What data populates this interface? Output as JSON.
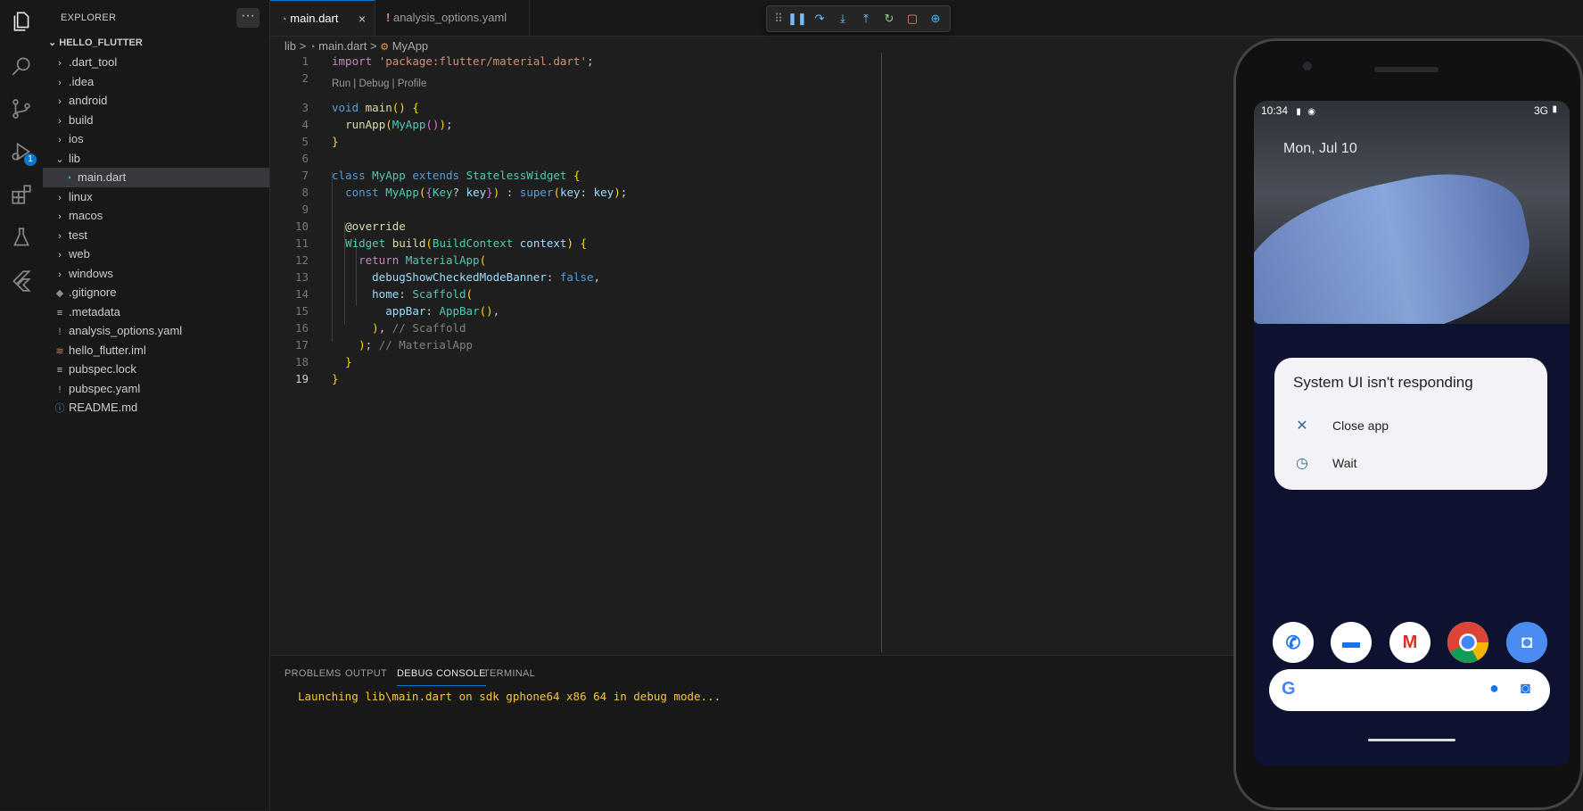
{
  "activity_bar": {
    "icons": [
      "explorer-icon",
      "search-icon",
      "source-control-icon",
      "run-debug-icon",
      "extensions-icon",
      "testing-icon",
      "flutter-icon"
    ],
    "debug_badge": "1"
  },
  "explorer": {
    "header": "EXPLORER",
    "more": "···",
    "root": "HELLO_FLUTTER",
    "items": [
      {
        "label": ".dart_tool",
        "kind": "folder"
      },
      {
        "label": ".idea",
        "kind": "folder"
      },
      {
        "label": "android",
        "kind": "folder"
      },
      {
        "label": "build",
        "kind": "folder"
      },
      {
        "label": "ios",
        "kind": "folder"
      },
      {
        "label": "lib",
        "kind": "folder-open"
      },
      {
        "label": "main.dart",
        "kind": "dart"
      },
      {
        "label": "linux",
        "kind": "folder"
      },
      {
        "label": "macos",
        "kind": "folder"
      },
      {
        "label": "test",
        "kind": "folder"
      },
      {
        "label": "web",
        "kind": "folder"
      },
      {
        "label": "windows",
        "kind": "folder"
      },
      {
        "label": ".gitignore",
        "kind": "git"
      },
      {
        "label": ".metadata",
        "kind": "lines"
      },
      {
        "label": "analysis_options.yaml",
        "kind": "yaml"
      },
      {
        "label": "hello_flutter.iml",
        "kind": "rss"
      },
      {
        "label": "pubspec.lock",
        "kind": "lines"
      },
      {
        "label": "pubspec.yaml",
        "kind": "yaml"
      },
      {
        "label": "README.md",
        "kind": "info"
      }
    ]
  },
  "tabs": [
    {
      "label": "main.dart",
      "close": "×"
    },
    {
      "label": "analysis_options.yaml"
    }
  ],
  "debug_toolbar": {
    "buttons": [
      "drag-handle-icon",
      "pause-icon",
      "step-over-icon",
      "step-into-icon",
      "step-out-icon",
      "restart-icon",
      "stop-icon",
      "inspect-widget-icon"
    ]
  },
  "breadcrumb": {
    "parts": [
      "lib",
      "main.dart",
      "MyApp"
    ],
    "sep": ">"
  },
  "editor": {
    "codelens": "Run | Debug | Profile",
    "lines": [
      {
        "n": "1",
        "text": "import 'package:flutter/material.dart';"
      },
      {
        "n": "2",
        "text": ""
      },
      {
        "n": "3",
        "text": "void main() {"
      },
      {
        "n": "4",
        "text": "  runApp(MyApp());"
      },
      {
        "n": "5",
        "text": "}"
      },
      {
        "n": "6",
        "text": ""
      },
      {
        "n": "7",
        "text": "class MyApp extends StatelessWidget {"
      },
      {
        "n": "8",
        "text": "  const MyApp({Key? key}) : super(key: key);"
      },
      {
        "n": "9",
        "text": ""
      },
      {
        "n": "10",
        "text": "  @override"
      },
      {
        "n": "11",
        "text": "  Widget build(BuildContext context) {"
      },
      {
        "n": "12",
        "text": "    return MaterialApp("
      },
      {
        "n": "13",
        "text": "      debugShowCheckedModeBanner: false,"
      },
      {
        "n": "14",
        "text": "      home: Scaffold("
      },
      {
        "n": "15",
        "text": "        appBar: AppBar(),"
      },
      {
        "n": "16",
        "text": "      ), // Scaffold"
      },
      {
        "n": "17",
        "text": "    ); // MaterialApp"
      },
      {
        "n": "18",
        "text": "  }"
      },
      {
        "n": "19",
        "text": "}"
      }
    ]
  },
  "panel": {
    "tabs": [
      "PROBLEMS",
      "OUTPUT",
      "DEBUG CONSOLE",
      "TERMINAL"
    ],
    "active_tab": "DEBUG CONSOLE",
    "console": "Launching lib\\main.dart on sdk gphone64 x86 64 in debug mode..."
  },
  "phone": {
    "time": "10:34",
    "network": "3G",
    "date": "Mon, Jul 10",
    "dialog": {
      "title": "System UI isn't responding",
      "options": [
        "Close app",
        "Wait"
      ]
    },
    "dock": [
      "phone-app-icon",
      "messages-app-icon",
      "gmail-app-icon",
      "chrome-app-icon",
      "camera-app-icon"
    ]
  },
  "colors": {
    "accent": "#0078d4",
    "console_text": "#f5c542",
    "dialog_bg": "#f3f3f7"
  }
}
